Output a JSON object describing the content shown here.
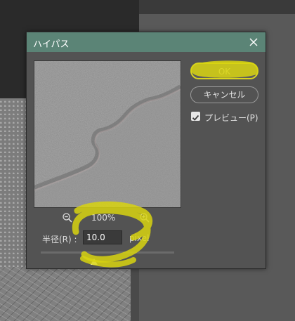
{
  "dialog": {
    "title": "ハイパス",
    "zoom_level": "100%",
    "radius": {
      "label": "半径(R) :",
      "value": "10.0",
      "unit": "pixel",
      "slider_fraction": 0.4
    },
    "buttons": {
      "ok": "OK",
      "cancel": "キャンセル"
    },
    "preview_option": {
      "label": "プレビュー(P)",
      "checked": true
    }
  },
  "colors": {
    "titlebar": "#5b8476",
    "dialog_bg": "#535353",
    "annotation": "#e2de10"
  },
  "icons": [
    "close-icon",
    "zoom-out-icon",
    "zoom-in-icon",
    "checkmark-icon",
    "slider-thumb-icon"
  ]
}
